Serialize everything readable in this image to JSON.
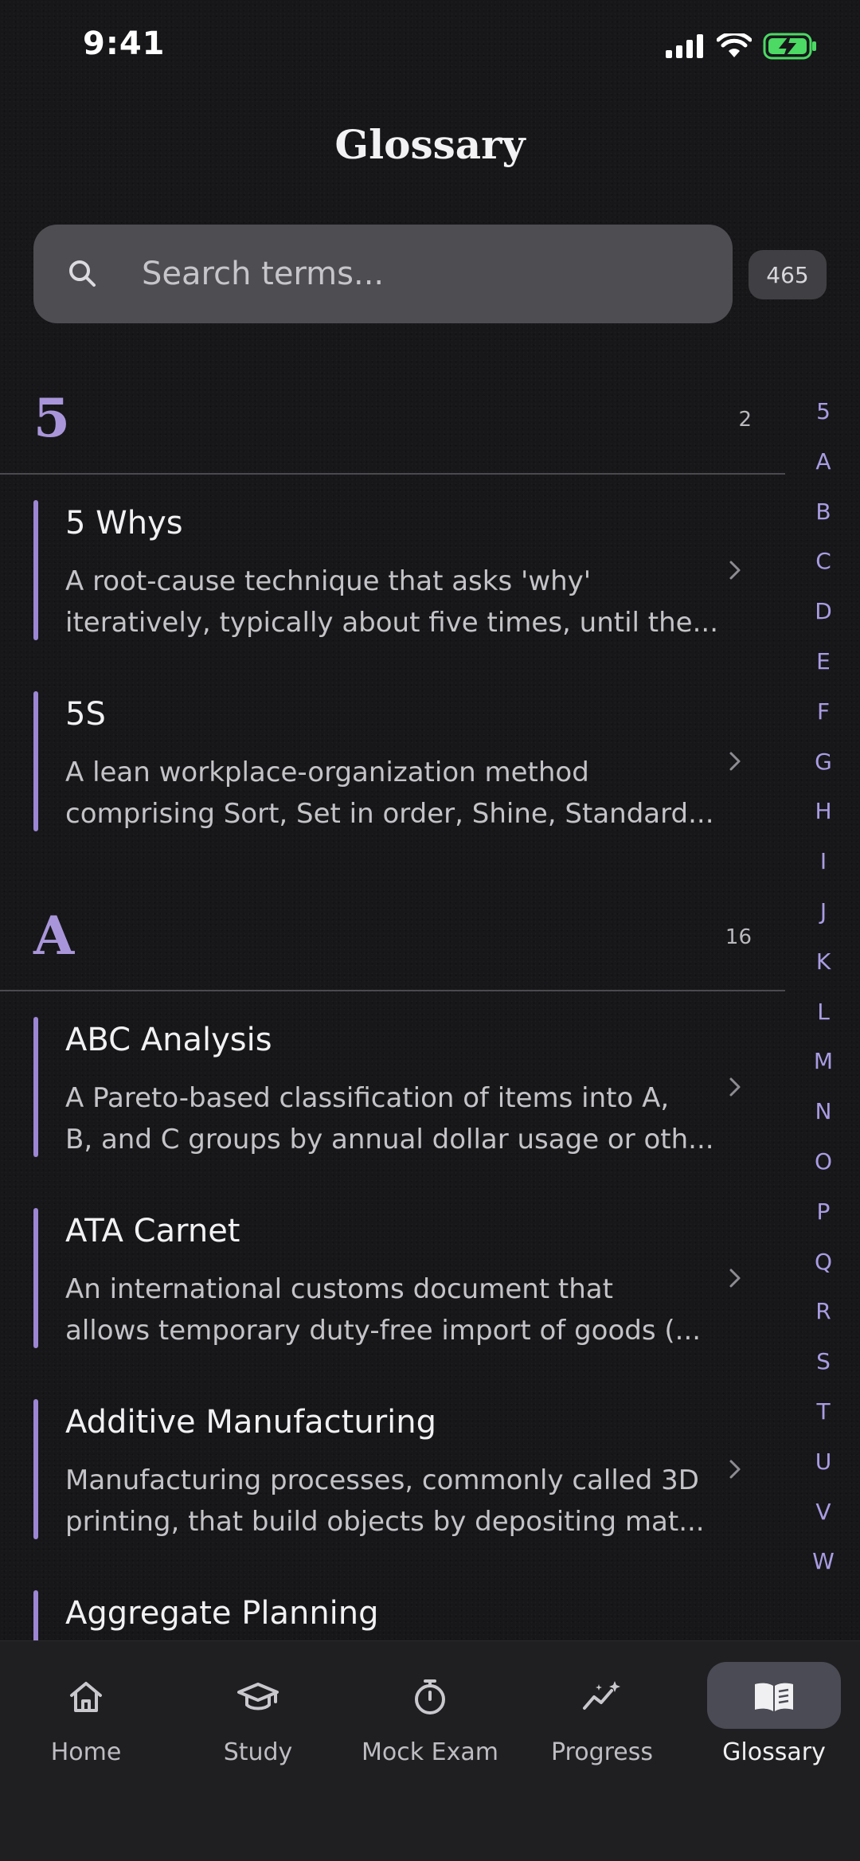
{
  "status_bar": {
    "time": "9:41"
  },
  "header": {
    "title": "Glossary"
  },
  "search": {
    "placeholder": "Search terms...",
    "value": "",
    "total_count": "465"
  },
  "sections": [
    {
      "letter": "5",
      "count": "2",
      "entries": [
        {
          "title": "5 Whys",
          "desc_line1": "A root-cause technique that asks 'why'",
          "desc_line2": "iteratively, typically about five times, until the..."
        },
        {
          "title": "5S",
          "desc_line1": "A lean workplace-organization method",
          "desc_line2": "comprising Sort, Set in order, Shine, Standard..."
        }
      ]
    },
    {
      "letter": "A",
      "count": "16",
      "entries": [
        {
          "title": "ABC Analysis",
          "desc_line1": "A Pareto-based classification of items into A,",
          "desc_line2": "B, and C groups by annual dollar usage or oth..."
        },
        {
          "title": "ATA Carnet",
          "desc_line1": "An international customs document that",
          "desc_line2": "allows temporary duty-free import of goods (..."
        },
        {
          "title": "Additive Manufacturing",
          "desc_line1": "Manufacturing processes, commonly called 3D",
          "desc_line2": "printing, that build objects by depositing mat..."
        },
        {
          "title": "Aggregate Planning",
          "desc_line1": "",
          "desc_line2": ""
        }
      ]
    }
  ],
  "index_letters": [
    "5",
    "A",
    "B",
    "C",
    "D",
    "E",
    "F",
    "G",
    "H",
    "I",
    "J",
    "K",
    "L",
    "M",
    "N",
    "O",
    "P",
    "Q",
    "R",
    "S",
    "T",
    "U",
    "V",
    "W"
  ],
  "tabs": [
    {
      "label": "Home",
      "icon": "home-icon"
    },
    {
      "label": "Study",
      "icon": "graduation-cap-icon"
    },
    {
      "label": "Mock Exam",
      "icon": "stopwatch-icon"
    },
    {
      "label": "Progress",
      "icon": "trend-sparkle-icon"
    },
    {
      "label": "Glossary",
      "icon": "open-book-icon",
      "active": true
    }
  ],
  "colors": {
    "accent": "#9C86D4",
    "letter": "#A996DA",
    "index": "#A99CE2",
    "battery": "#4CD964"
  }
}
